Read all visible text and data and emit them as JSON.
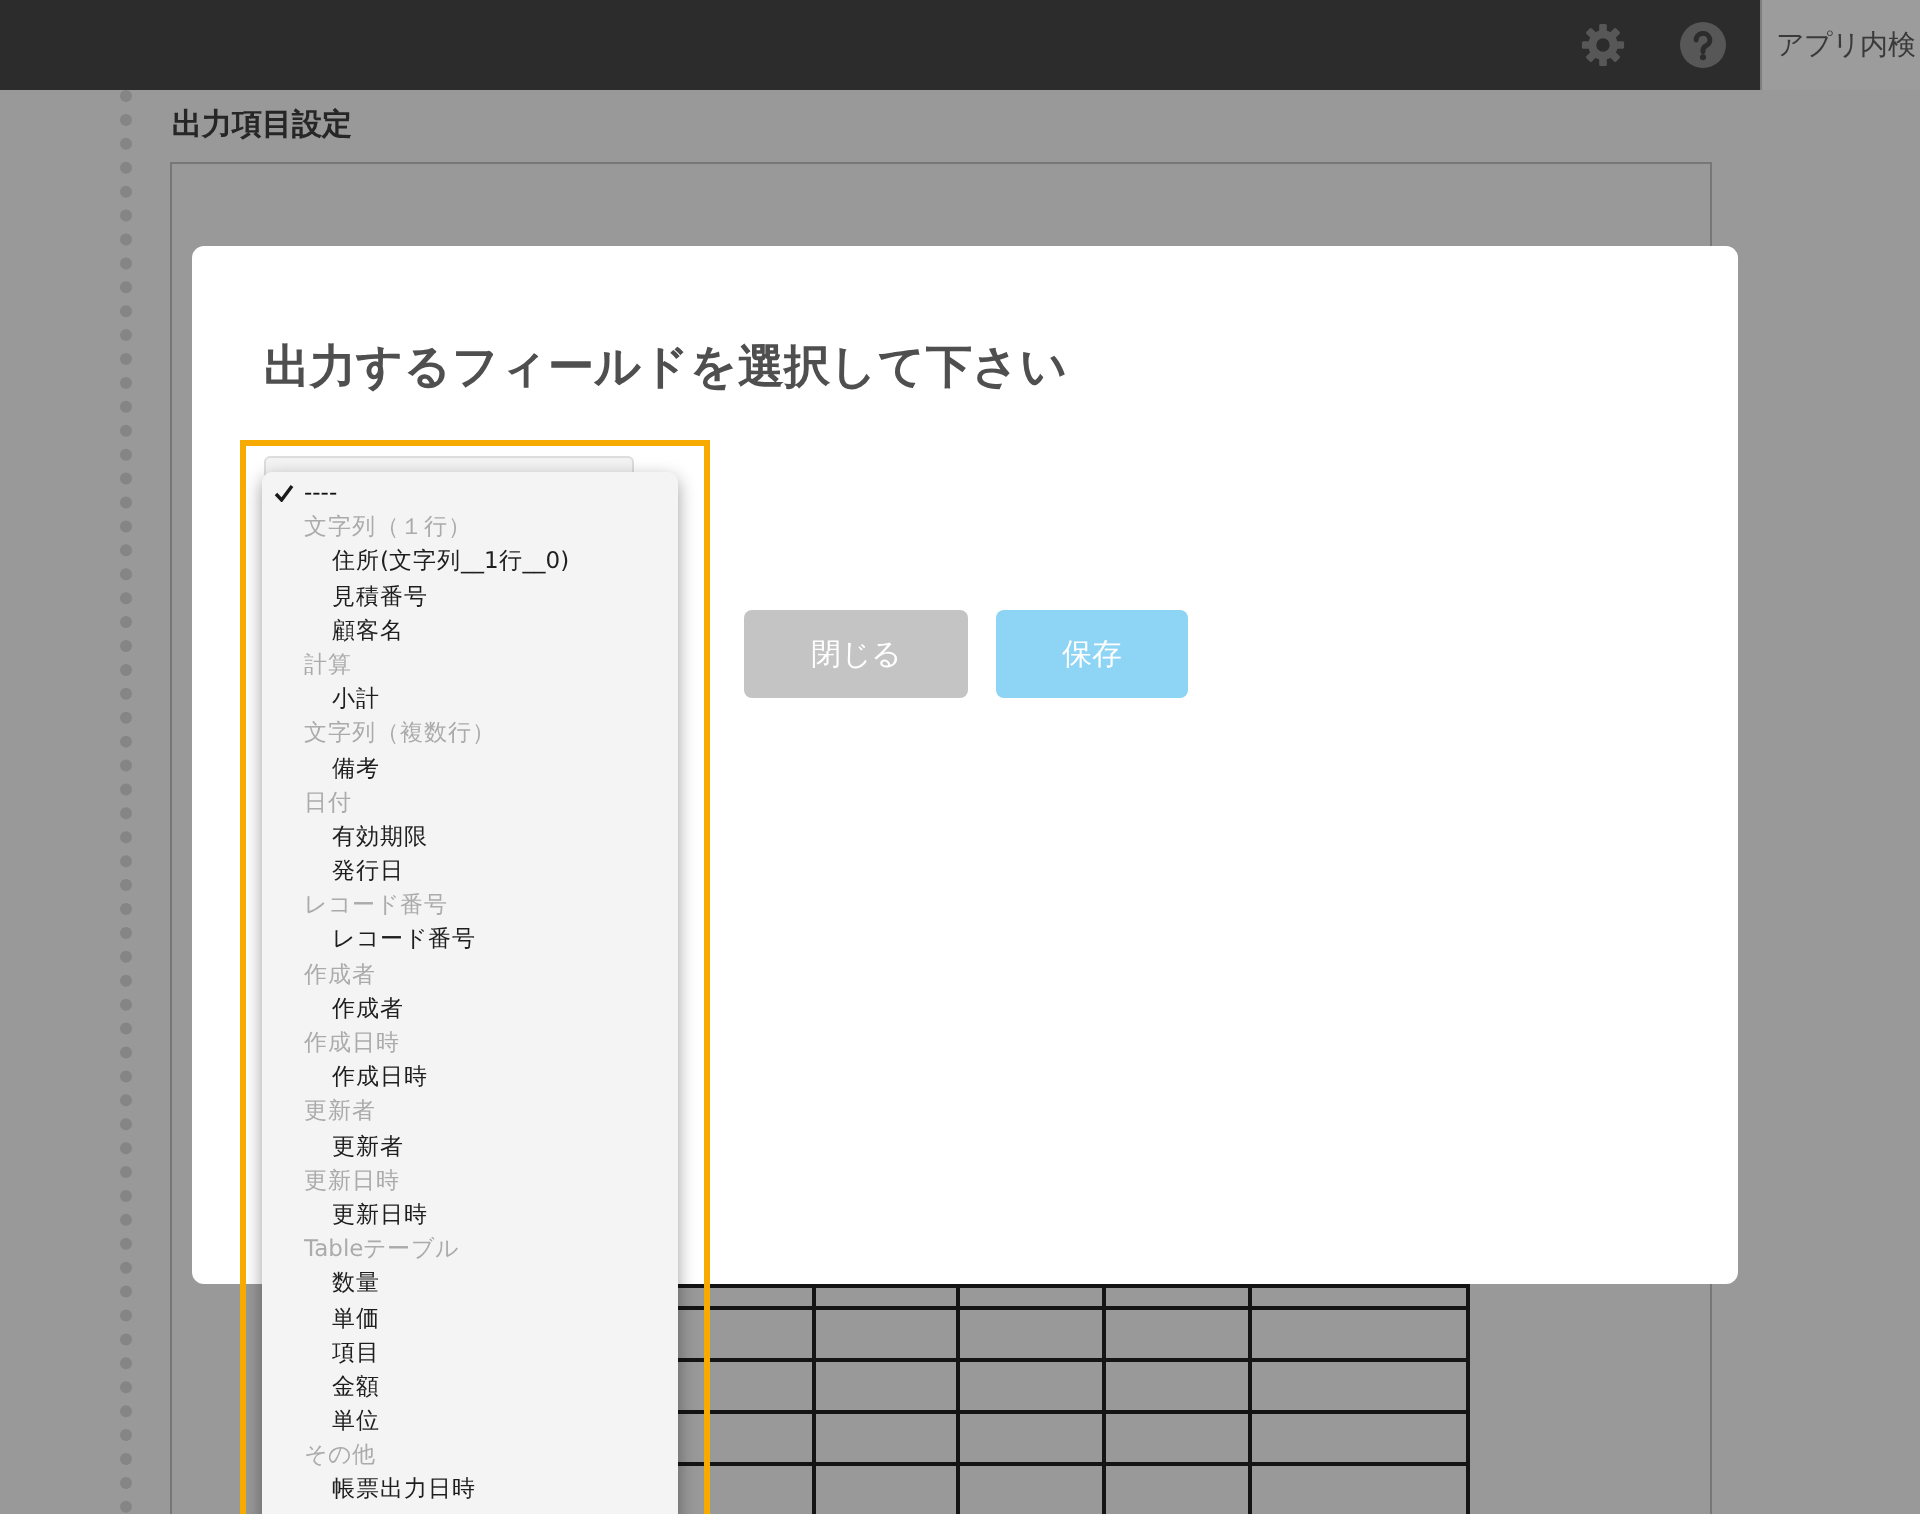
{
  "top_bar": {
    "search": {
      "placeholder": "アプリ内検"
    }
  },
  "page": {
    "heading": "出力項目設定"
  },
  "dialog": {
    "title": "出力するフィールドを選択して下さい",
    "field_select": {
      "menu": [
        {
          "kind": "option",
          "label": "----",
          "selected": true
        },
        {
          "kind": "group",
          "label": "文字列（１行）",
          "children": [
            {
              "label": "住所(文字列__1行__0)",
              "selected": false
            },
            {
              "label": "見積番号",
              "selected": false
            },
            {
              "label": "顧客名",
              "selected": false
            }
          ]
        },
        {
          "kind": "group",
          "label": "計算",
          "children": [
            {
              "label": "小計",
              "selected": false
            }
          ]
        },
        {
          "kind": "group",
          "label": "文字列（複数行）",
          "children": [
            {
              "label": "備考",
              "selected": false
            }
          ]
        },
        {
          "kind": "group",
          "label": "日付",
          "children": [
            {
              "label": "有効期限",
              "selected": false
            },
            {
              "label": "発行日",
              "selected": false
            }
          ]
        },
        {
          "kind": "group",
          "label": "レコード番号",
          "children": [
            {
              "label": "レコード番号",
              "selected": false
            }
          ]
        },
        {
          "kind": "group",
          "label": "作成者",
          "children": [
            {
              "label": "作成者",
              "selected": false
            }
          ]
        },
        {
          "kind": "group",
          "label": "作成日時",
          "children": [
            {
              "label": "作成日時",
              "selected": false
            }
          ]
        },
        {
          "kind": "group",
          "label": "更新者",
          "children": [
            {
              "label": "更新者",
              "selected": false
            }
          ]
        },
        {
          "kind": "group",
          "label": "更新日時",
          "children": [
            {
              "label": "更新日時",
              "selected": false
            }
          ]
        },
        {
          "kind": "group",
          "label": "Tableテーブル",
          "children": [
            {
              "label": "数量",
              "selected": false
            },
            {
              "label": "単価",
              "selected": false
            },
            {
              "label": "項目",
              "selected": false
            },
            {
              "label": "金額",
              "selected": false
            },
            {
              "label": "単位",
              "selected": false
            }
          ]
        },
        {
          "kind": "group",
          "label": "その他",
          "children": [
            {
              "label": "帳票出力日時",
              "selected": false
            }
          ]
        }
      ]
    },
    "buttons": [
      {
        "kind": "close",
        "label": "閉じる"
      },
      {
        "kind": "save",
        "label": "保存"
      }
    ]
  }
}
